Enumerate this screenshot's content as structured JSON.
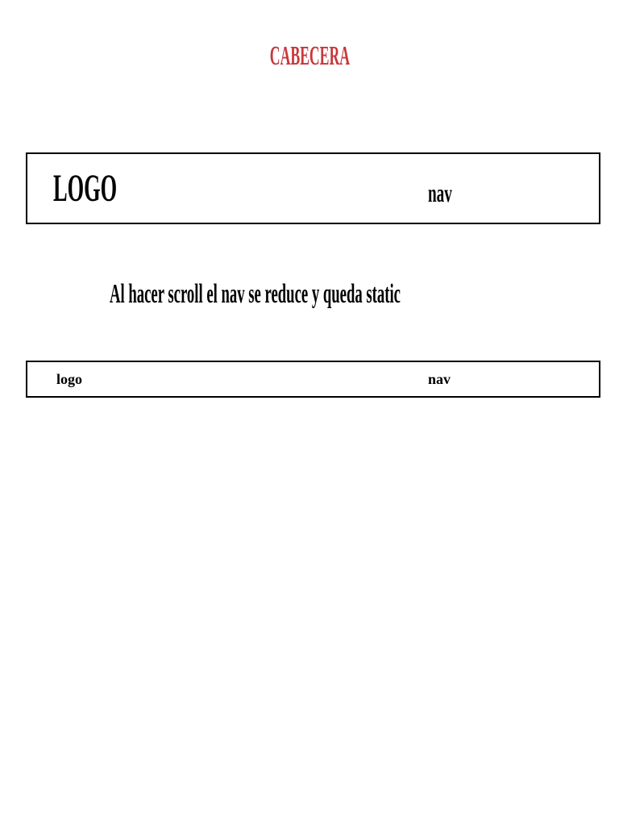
{
  "header": {
    "title": "CABECERA"
  },
  "nav_large": {
    "logo": "LOGO",
    "nav": "nav"
  },
  "caption": "Al hacer scroll el nav se reduce y queda static",
  "nav_small": {
    "logo": "logo",
    "nav": "nav"
  },
  "colors": {
    "title": "#c8373b",
    "text": "#000000",
    "border": "#000000",
    "background": "#ffffff"
  }
}
